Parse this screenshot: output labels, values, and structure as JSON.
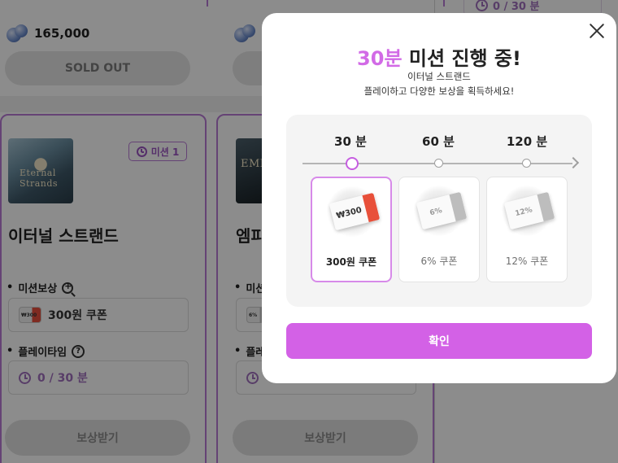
{
  "colors": {
    "accent": "#d361e6",
    "card_border": "#b87ad6",
    "overlay": "rgba(0,0,0,0.45)"
  },
  "background": {
    "top_items": [
      {
        "price": "165,000",
        "button": "SOLD OUT",
        "icon": "gem-icon"
      },
      {
        "price": "",
        "button": "",
        "icon": "gem-icon"
      }
    ],
    "top_right_time": "0 / 30 분",
    "cards": [
      {
        "mission_badge": "미션 1",
        "thumbnail_text": "Eternal Strands",
        "title": "이터널 스트랜드",
        "reward_label": "미션보상",
        "reward_value": "300원 쿠폰",
        "playtime_label": "플레이타임",
        "playtime_value": "0 / 30 분",
        "claim_button": "보상받기"
      },
      {
        "mission_badge": "",
        "thumbnail_text": "EMP",
        "title": "엠피",
        "reward_label": "미션",
        "reward_value": "",
        "playtime_label": "플레",
        "playtime_value": "",
        "claim_button": "보상받기"
      }
    ]
  },
  "modal": {
    "title_highlight": "30분",
    "title_rest": " 미션 진행 중!",
    "subtitle": "이터널 스트랜드",
    "description": "플레이하고 다양한 보상을 획득하세요!",
    "progress": {
      "current_step": 0,
      "current_minutes": 30
    },
    "milestones": [
      {
        "label": "30 분",
        "ticket_text": "₩300",
        "reward": "300원 쿠폰",
        "active": true
      },
      {
        "label": "60 분",
        "ticket_text": "6%",
        "reward": "6% 쿠폰",
        "active": false
      },
      {
        "label": "120 분",
        "ticket_text": "12%",
        "reward": "12% 쿠폰",
        "active": false
      }
    ],
    "confirm_button": "확인",
    "close_icon": "close-icon"
  }
}
